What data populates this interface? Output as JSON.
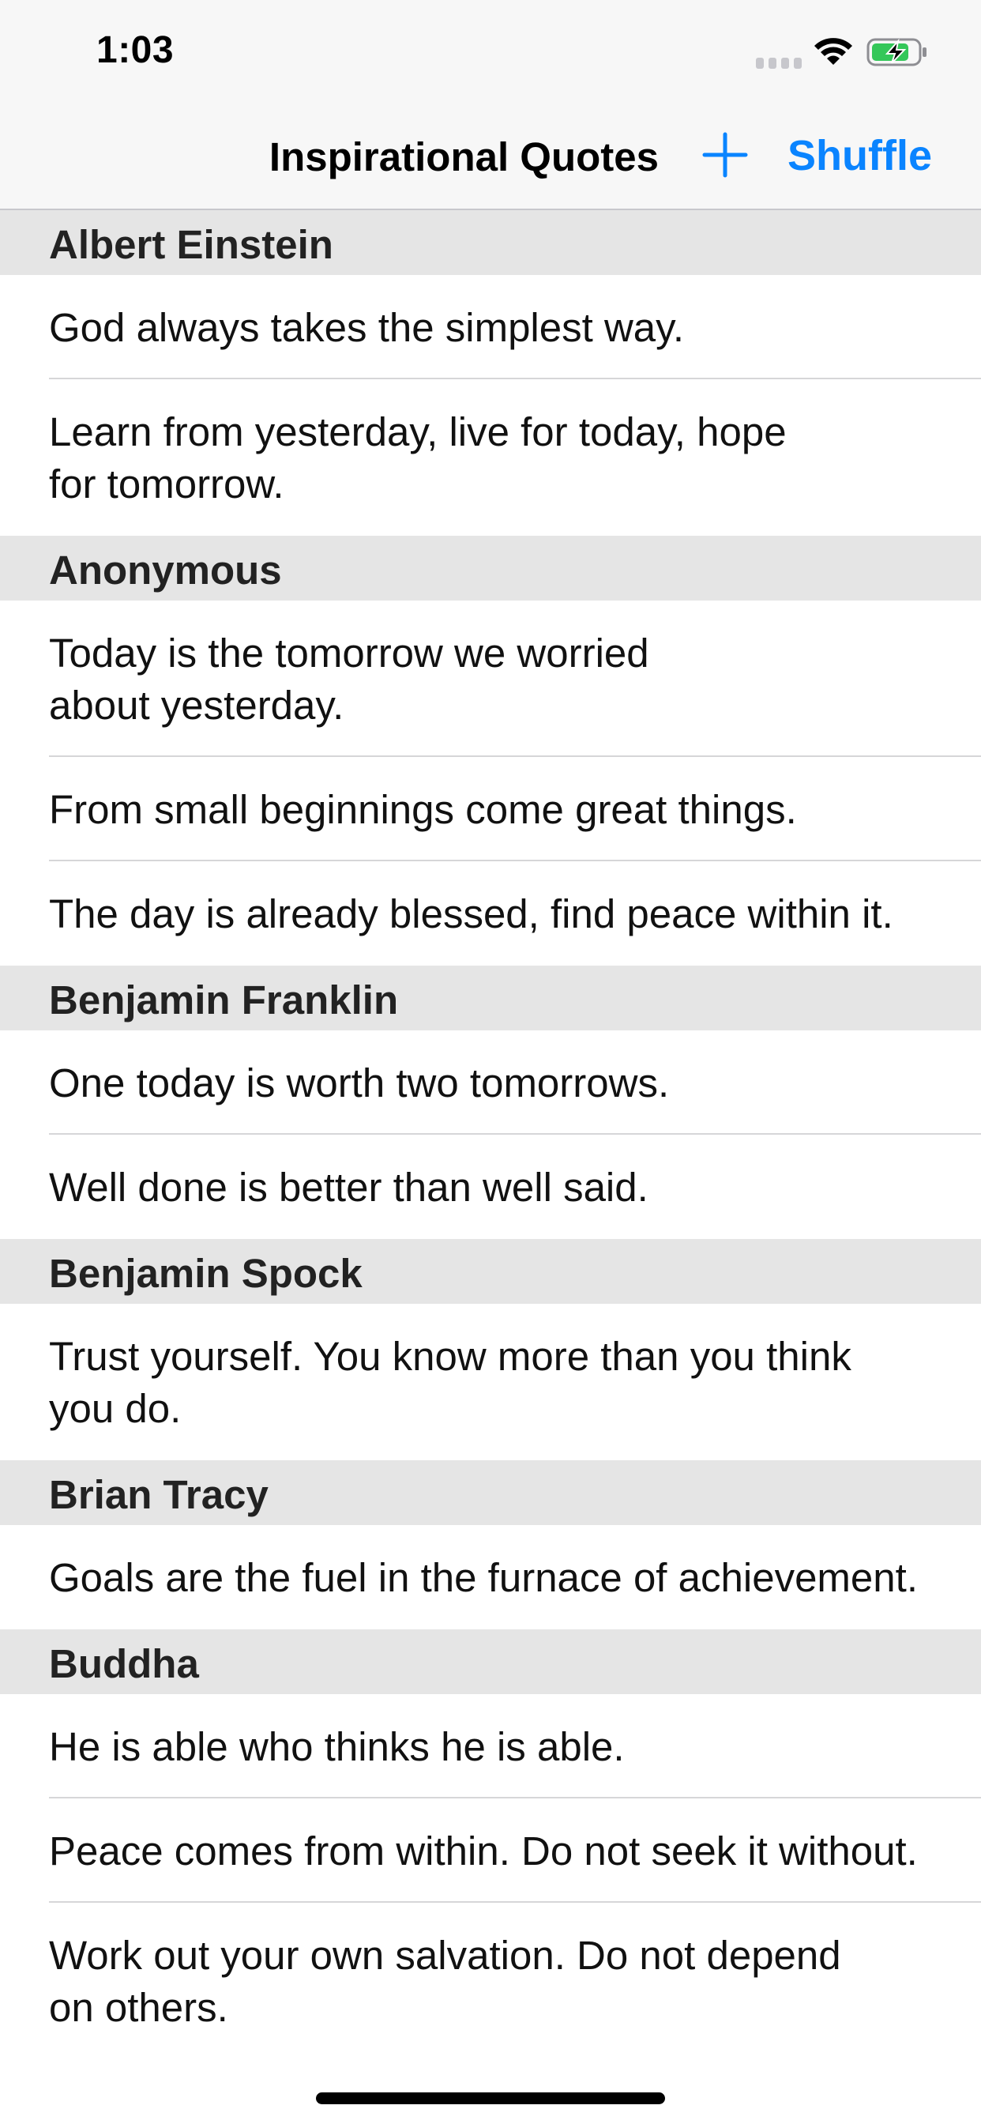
{
  "status_bar": {
    "time": "1:03",
    "signal_icon": "cellular-signal-icon",
    "wifi_icon": "wifi-icon",
    "battery_icon": "battery-charging-icon",
    "battery_color": "#34c759"
  },
  "nav": {
    "title": "Inspirational Quotes",
    "add_icon": "plus-icon",
    "shuffle_label": "Shuffle",
    "accent_color": "#0a84ff"
  },
  "sections": [
    {
      "author": "Albert Einstein",
      "quotes": [
        "God always takes the simplest way.",
        "Learn from yesterday, live for today, hope\nfor tomorrow."
      ]
    },
    {
      "author": "Anonymous",
      "quotes": [
        "Today is the tomorrow we worried\nabout yesterday.",
        "From small beginnings come great things.",
        "The day is already blessed, find peace within it."
      ]
    },
    {
      "author": "Benjamin Franklin",
      "quotes": [
        "One today is worth two tomorrows.",
        "Well done is better than well said."
      ]
    },
    {
      "author": "Benjamin Spock",
      "quotes": [
        "Trust yourself. You know more than you think\nyou do."
      ]
    },
    {
      "author": "Brian Tracy",
      "quotes": [
        "Goals are the fuel in the furnace of achievement."
      ]
    },
    {
      "author": "Buddha",
      "quotes": [
        "He is able who thinks he is able.",
        "Peace comes from within. Do not seek it without.",
        "Work out your own salvation. Do not depend\non others."
      ]
    }
  ]
}
